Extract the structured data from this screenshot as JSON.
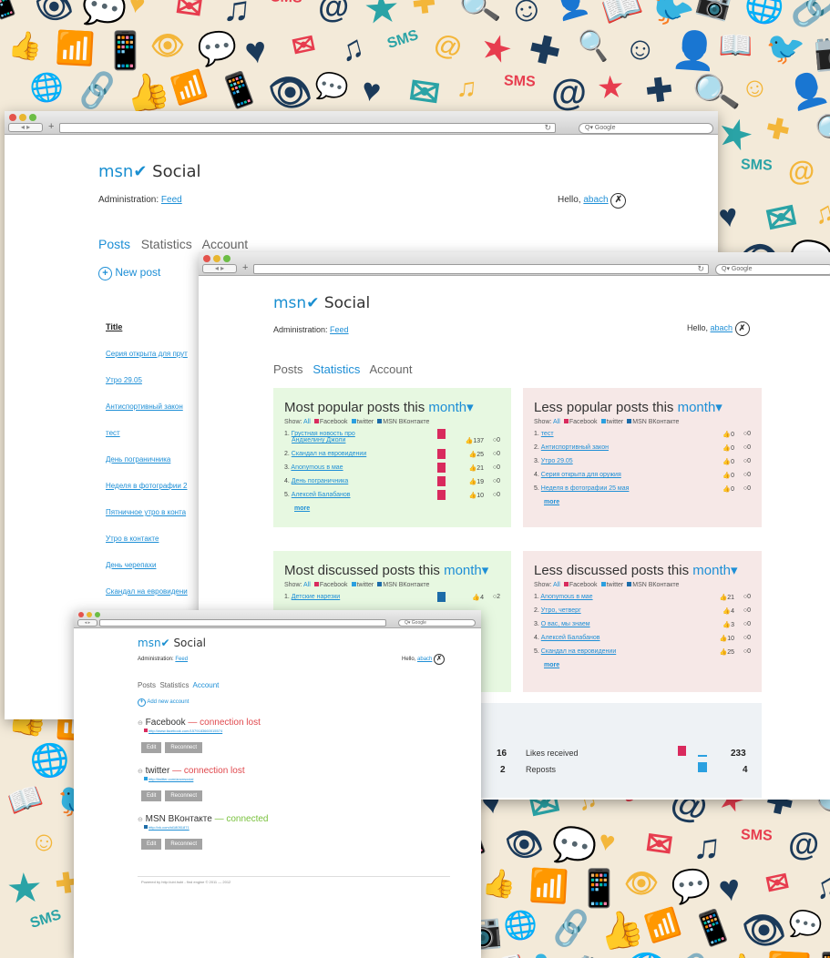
{
  "background": {
    "icons": [
      {
        "glyph": "📱",
        "name": "phone-icon"
      },
      {
        "glyph": "👁",
        "name": "eye-icon"
      },
      {
        "glyph": "💬",
        "name": "speech-bubble-icon"
      },
      {
        "glyph": "♥",
        "name": "heart-icon"
      },
      {
        "glyph": "✉",
        "name": "envelope-icon"
      },
      {
        "glyph": "♫",
        "name": "music-note-icon"
      },
      {
        "glyph": "SMS",
        "name": "sms-icon"
      },
      {
        "glyph": "@",
        "name": "at-sign-icon"
      },
      {
        "glyph": "★",
        "name": "star-icon"
      },
      {
        "glyph": "✚",
        "name": "plus-icon"
      },
      {
        "glyph": "🔍",
        "name": "magnifier-icon"
      },
      {
        "glyph": "☺",
        "name": "smiley-icon"
      },
      {
        "glyph": "👤",
        "name": "person-head-icon"
      },
      {
        "glyph": "📖",
        "name": "book-icon"
      },
      {
        "glyph": "🐦",
        "name": "bird-icon"
      },
      {
        "glyph": "📷",
        "name": "camera-icon"
      },
      {
        "glyph": "🌐",
        "name": "globe-icon"
      },
      {
        "glyph": "🔗",
        "name": "chain-link-icon"
      },
      {
        "glyph": "👍",
        "name": "thumbs-up-icon"
      },
      {
        "glyph": "📶",
        "name": "rss-icon"
      }
    ]
  },
  "colors": {
    "accent": "#1e8fd6",
    "facebook": "#d92a5d",
    "twitter": "#2aa0e0",
    "vk": "#1d6ca8",
    "lost": "#e0474c",
    "connected": "#79c13d"
  },
  "common": {
    "brand_msn": "msn",
    "brand_social": "Social",
    "admin_label": "Administration:",
    "admin_link": "Feed",
    "hello": "Hello,",
    "user": "abach",
    "tab_posts": "Posts",
    "tab_statistics": "Statistics",
    "tab_account": "Account",
    "search_placeholder": "Q▾ Google",
    "show": "Show:",
    "all": "All",
    "facebook": "Facebook",
    "twitter": "twitter",
    "vk": "MSN ВКонтакте",
    "more": "more",
    "month": "month▾"
  },
  "window1": {
    "new_post": "New post",
    "title_header": "Title",
    "items": [
      "Серия открыта для прут",
      "Утро 29.05",
      "Антиспортивный закон",
      "тест",
      "День пограничника",
      "Неделя в фотографии 2",
      "Пятничное утро в конта",
      "Утро в контакте",
      "День черепахи",
      "Скандал на евровидени"
    ]
  },
  "window2": {
    "most_popular_title": "Most popular posts this",
    "less_popular_title": "Less popular posts this",
    "most_discussed_title": "Most discussed posts this",
    "less_discussed_title": "Less discussed posts this",
    "most_popular": [
      {
        "n": "1.",
        "name": "Грустная новость про",
        "name2": "Анджелину Джоли",
        "likes": "137",
        "comments": "0"
      },
      {
        "n": "2.",
        "name": "Скандал на евровидении",
        "likes": "25",
        "comments": "0"
      },
      {
        "n": "3.",
        "name": "Anonymous в мае",
        "likes": "21",
        "comments": "0"
      },
      {
        "n": "4.",
        "name": "День пограничника",
        "likes": "19",
        "comments": "0"
      },
      {
        "n": "5.",
        "name": "Алексей Балабанов",
        "likes": "10",
        "comments": "0"
      }
    ],
    "less_popular": [
      {
        "n": "1.",
        "name": "тест",
        "likes": "0",
        "comments": "0"
      },
      {
        "n": "2.",
        "name": "Антиспортивный закон",
        "likes": "0",
        "comments": "0"
      },
      {
        "n": "3.",
        "name": "Утро 29.05",
        "likes": "0",
        "comments": "0"
      },
      {
        "n": "4.",
        "name": "Серия открыта для оружия",
        "likes": "0",
        "comments": "0"
      },
      {
        "n": "5.",
        "name": "Неделя в фотографии 25 мая",
        "likes": "0",
        "comments": "0"
      }
    ],
    "most_discussed": [
      {
        "n": "1.",
        "name": "Детские нарезки",
        "likes": "4",
        "comments": "2"
      }
    ],
    "less_discussed": [
      {
        "n": "1.",
        "name": "Anonymous в мае",
        "likes": "21",
        "comments": "0"
      },
      {
        "n": "2.",
        "name": "Утро, четверг",
        "likes": "4",
        "comments": "0"
      },
      {
        "n": "3.",
        "name": "О вас, мы знаем",
        "likes": "3",
        "comments": "0"
      },
      {
        "n": "4.",
        "name": "Алексей Балабанов",
        "likes": "10",
        "comments": "0"
      },
      {
        "n": "5.",
        "name": "Скандал на евровидении",
        "likes": "25",
        "comments": "0"
      }
    ],
    "summary_left": [
      "16",
      "2"
    ],
    "summary": [
      {
        "label": "Likes received",
        "value": "233"
      },
      {
        "label": "Reposts",
        "value": "4"
      }
    ]
  },
  "window3": {
    "add_account": "Add new account",
    "accounts": [
      {
        "name": "Facebook",
        "sep": "—",
        "status": "connection lost",
        "url": "http://www.facebook.com/1579183660015574",
        "color": "#d92a5d",
        "status_color": "#e0474c"
      },
      {
        "name": "twitter",
        "sep": "—",
        "status": "connection lost",
        "url": "http://twitter.com/anonsocial",
        "color": "#2aa0e0",
        "status_color": "#e0474c"
      },
      {
        "name": "MSN ВКонтакте",
        "sep": "—",
        "status": "connected",
        "url": "http://vk.com/id18051871",
        "color": "#1d6ca8",
        "status_color": "#79c13d"
      }
    ],
    "edit": "Edit",
    "reconnect": "Reconnect",
    "footer": "Powered by http://ubi.hubi - find engine © 2011 — 2012"
  }
}
